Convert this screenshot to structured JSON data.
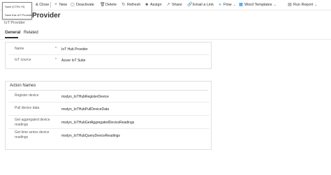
{
  "commands": {
    "save_close": "& Close",
    "new": "New",
    "deactivate": "Deactivate",
    "delete": "Delete",
    "refresh": "Refresh",
    "assign": "Assign",
    "share": "Share",
    "email_link": "Email a Link",
    "flow": "Flow",
    "word_templates": "Word Templates",
    "run_report": "Run Report"
  },
  "tooltip": {
    "shortcut": "Save (CTRL+S)",
    "description": "Save this IoT Provider"
  },
  "header": {
    "title": "IoT Hub Provider",
    "subtitle": "IoT Provider"
  },
  "tabs": [
    {
      "label": "General"
    },
    {
      "label": "Related"
    }
  ],
  "general_section": {
    "fields": [
      {
        "label": "Name",
        "required": "*",
        "value": "IoT Hub Provider"
      },
      {
        "label": "IoT source",
        "required": "*",
        "value": "Azure IoT Suite"
      }
    ]
  },
  "action_section": {
    "title": "Action Names",
    "fields": [
      {
        "label": "Register device",
        "value": "msdyn_IoTHubRegisterDevice"
      },
      {
        "label": "Pull device data",
        "value": "msdyn_IoTHubPullDeviceData"
      },
      {
        "label": "Get aggregated device readings",
        "value": "msdyn_IoTHubGetAggregatedDeviceReadings"
      },
      {
        "label": "Get time series device readings",
        "value": "msdyn_IoTHubQueryDeviceReadings"
      }
    ]
  },
  "colors": {
    "accent": "#0078d4",
    "text": "#323130",
    "subtle": "#605e5c",
    "border": "#e1dfdd"
  }
}
